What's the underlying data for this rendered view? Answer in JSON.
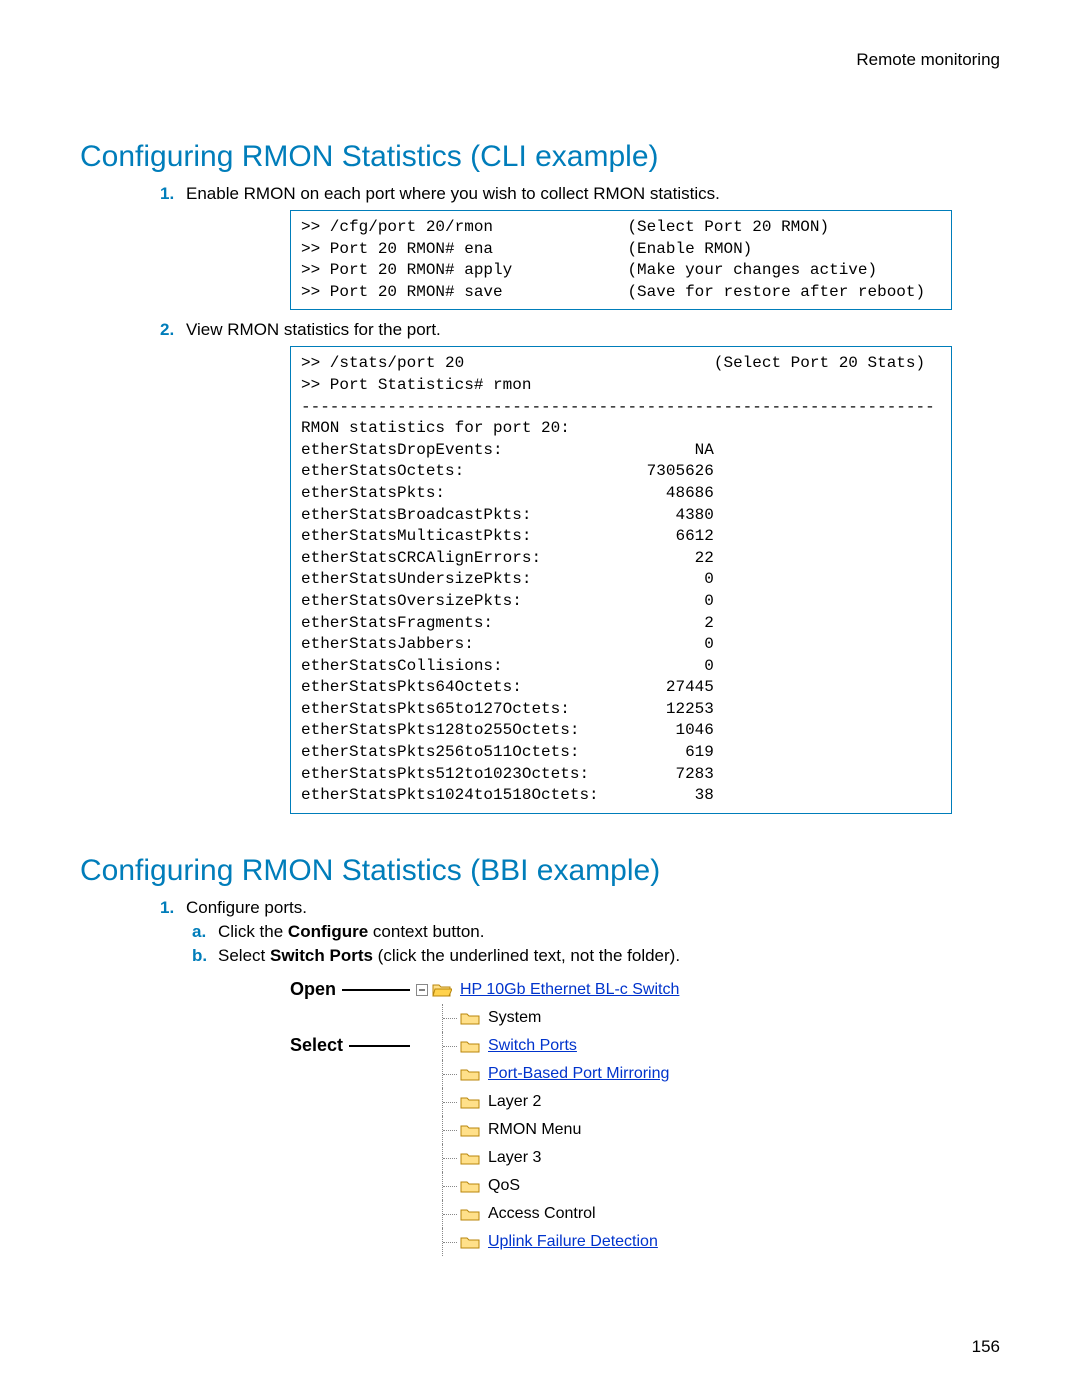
{
  "header": {
    "right": "Remote monitoring",
    "page_number": "156"
  },
  "section_cli": {
    "title": "Configuring RMON Statistics (CLI example)",
    "step1_marker": "1.",
    "step1_text": "Enable RMON on each port where you wish to collect RMON statistics.",
    "code1": ">> /cfg/port 20/rmon              (Select Port 20 RMON)\n>> Port 20 RMON# ena              (Enable RMON)\n>> Port 20 RMON# apply            (Make your changes active)\n>> Port 20 RMON# save             (Save for restore after reboot)",
    "step2_marker": "2.",
    "step2_text": "View RMON statistics for the port.",
    "code2": ">> /stats/port 20                          (Select Port 20 Stats)\n>> Port Statistics# rmon\n------------------------------------------------------------------\nRMON statistics for port 20:\netherStatsDropEvents:                    NA\netherStatsOctets:                   7305626\netherStatsPkts:                       48686\netherStatsBroadcastPkts:               4380\netherStatsMulticastPkts:               6612\netherStatsCRCAlignErrors:                22\netherStatsUndersizePkts:                  0\netherStatsOversizePkts:                   0\netherStatsFragments:                      2\netherStatsJabbers:                        0\netherStatsCollisions:                     0\netherStatsPkts64Octets:               27445\netherStatsPkts65to127Octets:          12253\netherStatsPkts128to255Octets:          1046\netherStatsPkts256to511Octets:           619\netherStatsPkts512to1023Octets:         7283\netherStatsPkts1024to1518Octets:          38"
  },
  "section_bbi": {
    "title": "Configuring RMON Statistics (BBI example)",
    "step1_marker": "1.",
    "step1_text": "Configure ports.",
    "step_a_marker": "a.",
    "step_a_prefix": "Click the ",
    "step_a_bold": "Configure",
    "step_a_suffix": " context button.",
    "step_b_marker": "b.",
    "step_b_prefix": "Select ",
    "step_b_bold": "Switch Ports",
    "step_b_suffix": " (click the underlined text, not the folder)."
  },
  "tree": {
    "annot_open": "Open",
    "annot_select": "Select",
    "root": "HP 10Gb Ethernet BL-c Switch",
    "items": [
      {
        "label": "System",
        "link": false
      },
      {
        "label": "Switch Ports",
        "link": true
      },
      {
        "label": "Port-Based Port Mirroring",
        "link": true
      },
      {
        "label": "Layer 2",
        "link": false
      },
      {
        "label": "RMON Menu",
        "link": false
      },
      {
        "label": "Layer 3",
        "link": false
      },
      {
        "label": "QoS",
        "link": false
      },
      {
        "label": "Access Control",
        "link": false
      },
      {
        "label": "Uplink Failure Detection",
        "link": true
      }
    ]
  }
}
